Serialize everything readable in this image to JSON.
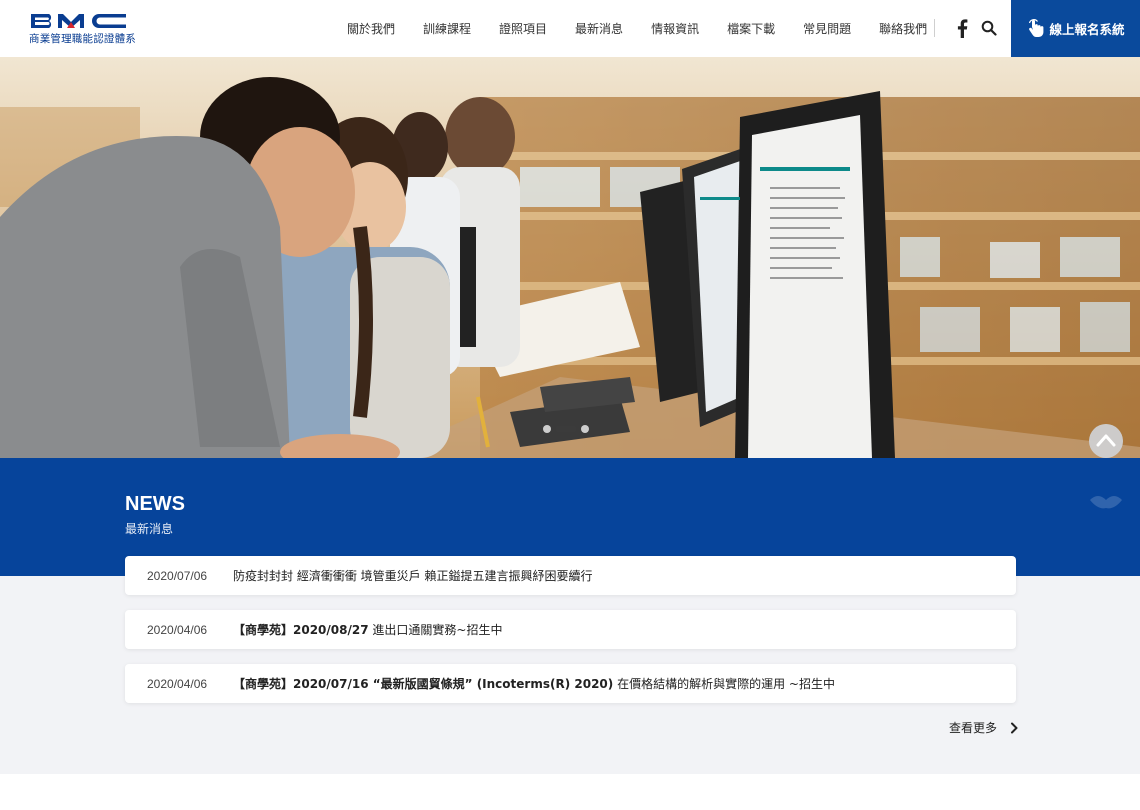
{
  "header": {
    "logo_letters": "BMC",
    "logo_subtitle": "商業管理職能認證體系",
    "nav": [
      {
        "label": "關於我們"
      },
      {
        "label": "訓練課程"
      },
      {
        "label": "證照項目"
      },
      {
        "label": "最新消息"
      },
      {
        "label": "情報資訊"
      },
      {
        "label": "檔案下載"
      },
      {
        "label": "常見問題"
      },
      {
        "label": "聯絡我們"
      }
    ],
    "social_icon": "facebook-icon",
    "search_icon": "search-icon",
    "signup_label": "線上報名系統",
    "signup_icon": "hand-pointer-icon"
  },
  "hero": {
    "carousel_dots": 3,
    "active_dot": 2
  },
  "news": {
    "title": "NEWS",
    "subtitle": "最新消息",
    "items": [
      {
        "date": "2020/07/06",
        "prefix": "",
        "text": "防疫封封封 經濟衝衝衝 境管重災戶 賴正鎰提五建言振興紓困要續行"
      },
      {
        "date": "2020/04/06",
        "prefix": "【商學苑】2020/08/27",
        "text": " 進出口通關實務~招生中"
      },
      {
        "date": "2020/04/06",
        "prefix": "【商學苑】2020/07/16 “最新版國貿條規” (Incoterms(R) 2020)",
        "text": " 在價格結構的解析與實際的運用 ~招生中"
      }
    ],
    "more_label": "查看更多"
  },
  "colors": {
    "brand_blue": "#06449b",
    "button_blue": "#0a4a9c",
    "news_bg": "#f2f3f6"
  }
}
